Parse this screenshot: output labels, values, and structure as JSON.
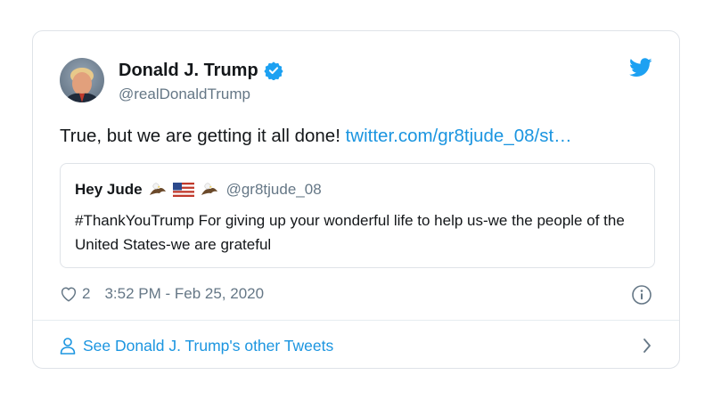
{
  "tweet": {
    "author_name": "Donald J. Trump",
    "author_handle": "@realDonaldTrump",
    "text": "True, but we are getting it all done! ",
    "link_text": "twitter.com/gr8tjude_08/st…",
    "likes": "2",
    "timestamp": "3:52 PM - Feb 25, 2020",
    "verified": true
  },
  "quoted_tweet": {
    "author_name": "Hey Jude",
    "author_handle": "@gr8tjude_08",
    "emoji_icons": [
      "eagle-icon",
      "us-flag-icon",
      "eagle-icon"
    ],
    "text": "#ThankYouTrump For giving up your wonderful life to help us-we the people of the United States-we are grateful"
  },
  "footer": {
    "label": "See Donald J. Trump's other Tweets"
  },
  "colors": {
    "link_blue": "#1b95e0",
    "twitter_blue": "#1da1f2",
    "secondary_text": "#657786",
    "border": "#dfe3e8"
  }
}
